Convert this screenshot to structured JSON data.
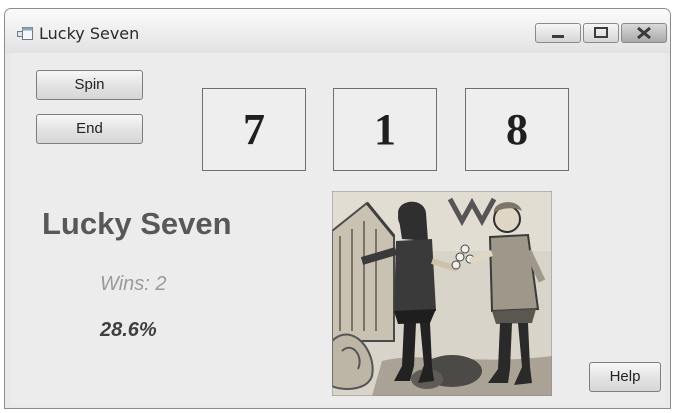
{
  "window": {
    "title": "Lucky Seven",
    "controls": [
      "minimize-icon",
      "maximize-icon",
      "close-icon"
    ]
  },
  "buttons": {
    "spin_label": "Spin",
    "end_label": "End",
    "help_label": "Help"
  },
  "slots": [
    "7",
    "1",
    "8"
  ],
  "heading": "Lucky Seven",
  "wins_text": "Wins: 2",
  "percentage_text": "28.6%",
  "picture": {
    "subject": "medieval-illustration-two-men-exchanging-coins"
  }
}
